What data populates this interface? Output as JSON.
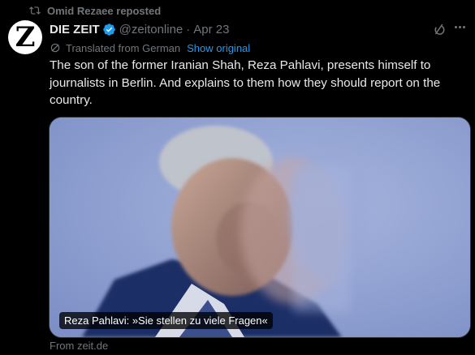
{
  "repost": {
    "text": "Omid Rezaee reposted",
    "icon": "repost-icon"
  },
  "author": {
    "avatar_letter": "Z",
    "name": "DIE ZEIT",
    "handle": "@zeitonline",
    "separator": "·",
    "date": "Apr 23",
    "verified_color": "#1d9bf0"
  },
  "translation": {
    "label": "Translated from German",
    "link": "Show original",
    "icon": "globe-icon"
  },
  "tweet": {
    "text": "The son of the former Iranian Shah, Reza Pahlavi, presents himself to journalists in Berlin. And explains to them how they should report on the country."
  },
  "media": {
    "caption": "Reza Pahlavi: »Sie stellen zu viele Fragen«"
  },
  "card": {
    "source": "From zeit.de"
  },
  "colors": {
    "accent": "#1d9bf0",
    "muted": "#71767b",
    "text": "#e7e9ea",
    "background": "#000000"
  }
}
